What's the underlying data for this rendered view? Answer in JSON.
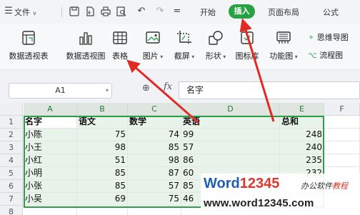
{
  "menu": {
    "menu_icon": "hamburger-icon",
    "file_label": "文件",
    "file_caret": "∨",
    "more": "≂",
    "tabs": [
      "开始",
      "插入",
      "页面布局",
      "公式"
    ]
  },
  "ribbon": {
    "pivot_table": "数据透视表",
    "pivot_chart": "数据透视图",
    "table": "表格",
    "picture": "图片",
    "screenshot": "截屏",
    "shapes": "形状",
    "icon_library": "图标库",
    "function_chart": "功能图",
    "mind_map": "思维导图",
    "flowchart": "流程图"
  },
  "formula_bar": {
    "cell_ref": "A1",
    "fx": "fx",
    "content": "名字"
  },
  "sheet": {
    "columns": [
      "A",
      "B",
      "C",
      "D",
      "E",
      "F"
    ],
    "rows": [
      "1",
      "2",
      "3",
      "4",
      "5",
      "6",
      "7",
      "8"
    ],
    "header": [
      "名字",
      "语文",
      "数学",
      "英语",
      "总和"
    ],
    "data": [
      [
        "小陈",
        "75",
        "74",
        "99",
        "248"
      ],
      [
        "小王",
        "98",
        "85",
        "57",
        "240"
      ],
      [
        "小红",
        "51",
        "98",
        "86",
        "235"
      ],
      [
        "小明",
        "85",
        "87",
        "60",
        "232"
      ],
      [
        "小张",
        "85",
        "57",
        "85",
        ""
      ],
      [
        "小吴",
        "69",
        "75",
        "46",
        ""
      ]
    ]
  },
  "watermark": {
    "brand_a": "Word",
    "brand_b": "12345",
    "tag_a": "办公软件",
    "tag_b": "教程",
    "url": "www.word12345.com"
  },
  "colors": {
    "accent": "#27a143",
    "arrow": "#e02a24"
  }
}
